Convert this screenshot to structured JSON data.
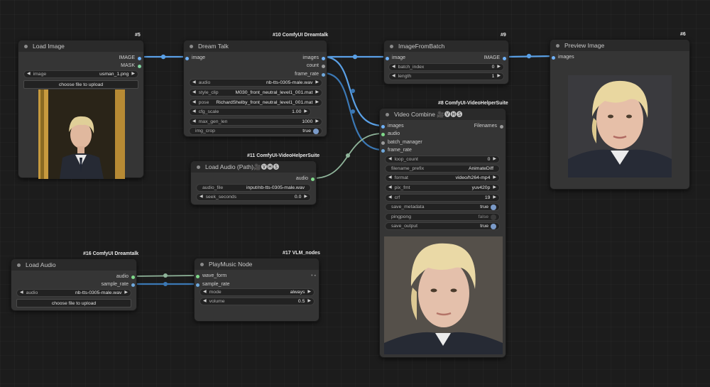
{
  "colors": {
    "image": "#6fb1f7",
    "mask": "#80d6a0",
    "audio": "#7fd98a",
    "int": "#7fa7d9",
    "number": "#6fa8dc",
    "gray": "#9a9a9a",
    "link_image": "#5aa0e6",
    "link_audio": "#8fb49a",
    "link_num": "#3b78b5"
  },
  "nodes": {
    "load_image": {
      "badge": "#5",
      "title": "Load Image",
      "outputs": [
        "IMAGE",
        "MASK"
      ],
      "image_label": "image",
      "image_value": "usman_1.png",
      "upload_label": "choose file to upload"
    },
    "dream_talk": {
      "badge": "#10 ComfyUI Dreamtalk",
      "title": "Dream Talk",
      "input": "image",
      "outputs": [
        "images",
        "count",
        "frame_rate"
      ],
      "widgets": [
        {
          "label": "audio",
          "value": "nb-tts-0305-male.wav"
        },
        {
          "label": "style_clip",
          "value": "M030_front_neutral_level1_001.mat"
        },
        {
          "label": "pose",
          "value": "RichardShelby_front_neutral_level1_001.mat"
        },
        {
          "label": "cfg_scale",
          "value": "1.00"
        },
        {
          "label": "max_gen_len",
          "value": "1000"
        }
      ],
      "toggle": {
        "label": "img_crop",
        "value": "true"
      }
    },
    "image_from_batch": {
      "badge": "#9",
      "title": "ImageFromBatch",
      "input": "image",
      "output": "IMAGE",
      "widgets": [
        {
          "label": "batch_index",
          "value": "0"
        },
        {
          "label": "length",
          "value": "1"
        }
      ]
    },
    "preview_image": {
      "badge": "#6",
      "title": "Preview Image",
      "input": "images"
    },
    "video_combine": {
      "badge": "#8 ComfyUI-VideoHelperSuite",
      "title": "Video Combine 🎥🅥🅗🅢",
      "inputs": [
        "images",
        "audio",
        "batch_manager",
        "frame_rate"
      ],
      "output": "Filenames",
      "widgets": [
        {
          "label": "loop_count",
          "value": "0"
        },
        {
          "label": "filename_prefix",
          "value": "AnimateDiff"
        },
        {
          "label": "format",
          "value": "video/h264-mp4"
        },
        {
          "label": "pix_fmt",
          "value": "yuv420p"
        },
        {
          "label": "crf",
          "value": "19"
        }
      ],
      "toggles": [
        {
          "label": "save_metadata",
          "value": "true"
        },
        {
          "label": "pingpong",
          "value": "false"
        },
        {
          "label": "save_output",
          "value": "true"
        }
      ]
    },
    "load_audio_path": {
      "badge": "#11 ComfyUI-VideoHelperSuite",
      "title": "Load Audio (Path)🎥🅥🅗🅢",
      "output": "audio",
      "widgets": [
        {
          "label": "audio_file",
          "value": "input/nb-tts-0305-male.wav"
        },
        {
          "label": "seek_seconds",
          "value": "0.0"
        }
      ]
    },
    "load_audio": {
      "badge": "#16 ComfyUI Dreamtalk",
      "title": "Load Audio",
      "outputs": [
        "audio",
        "sample_rate"
      ],
      "audio_label": "audio",
      "audio_value": "nb-tts-0305-male.wav",
      "upload_label": "choose file to upload"
    },
    "play_music": {
      "badge": "#17 VLM_nodes",
      "title": "PlayMusic Node",
      "inputs": [
        "wave_form",
        "sample_rate"
      ],
      "widgets": [
        {
          "label": "mode",
          "value": "always"
        },
        {
          "label": "volume",
          "value": "0.5"
        }
      ]
    }
  }
}
